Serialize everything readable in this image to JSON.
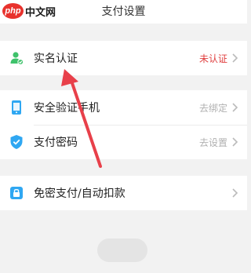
{
  "watermark": {
    "logo_text": "php",
    "site_text": "中文网"
  },
  "header": {
    "title": "支付设置"
  },
  "groups": [
    {
      "items": [
        {
          "label": "实名认证",
          "value": "未认证",
          "icon": "user-verified-icon",
          "value_color": "#e04040"
        }
      ]
    },
    {
      "items": [
        {
          "label": "安全验证手机",
          "value": "去绑定",
          "icon": "phone-icon"
        },
        {
          "label": "支付密码",
          "value": "去设置",
          "icon": "shield-check-icon"
        }
      ]
    },
    {
      "items": [
        {
          "label": "免密支付/自动扣款",
          "value": "",
          "icon": "lock-icon"
        }
      ]
    }
  ],
  "colors": {
    "accent_blue": "#2fa7f2",
    "accent_green": "#3fc26b",
    "warning_red": "#e04040",
    "annotation_arrow": "#e8404a"
  }
}
